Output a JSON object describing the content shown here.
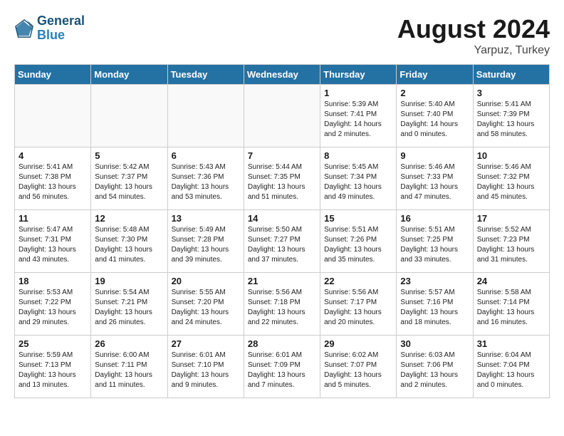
{
  "header": {
    "logo_line1": "General",
    "logo_line2": "Blue",
    "month_year": "August 2024",
    "location": "Yarpuz, Turkey"
  },
  "weekdays": [
    "Sunday",
    "Monday",
    "Tuesday",
    "Wednesday",
    "Thursday",
    "Friday",
    "Saturday"
  ],
  "weeks": [
    [
      {
        "day": "",
        "info": ""
      },
      {
        "day": "",
        "info": ""
      },
      {
        "day": "",
        "info": ""
      },
      {
        "day": "",
        "info": ""
      },
      {
        "day": "1",
        "info": "Sunrise: 5:39 AM\nSunset: 7:41 PM\nDaylight: 14 hours\nand 2 minutes."
      },
      {
        "day": "2",
        "info": "Sunrise: 5:40 AM\nSunset: 7:40 PM\nDaylight: 14 hours\nand 0 minutes."
      },
      {
        "day": "3",
        "info": "Sunrise: 5:41 AM\nSunset: 7:39 PM\nDaylight: 13 hours\nand 58 minutes."
      }
    ],
    [
      {
        "day": "4",
        "info": "Sunrise: 5:41 AM\nSunset: 7:38 PM\nDaylight: 13 hours\nand 56 minutes."
      },
      {
        "day": "5",
        "info": "Sunrise: 5:42 AM\nSunset: 7:37 PM\nDaylight: 13 hours\nand 54 minutes."
      },
      {
        "day": "6",
        "info": "Sunrise: 5:43 AM\nSunset: 7:36 PM\nDaylight: 13 hours\nand 53 minutes."
      },
      {
        "day": "7",
        "info": "Sunrise: 5:44 AM\nSunset: 7:35 PM\nDaylight: 13 hours\nand 51 minutes."
      },
      {
        "day": "8",
        "info": "Sunrise: 5:45 AM\nSunset: 7:34 PM\nDaylight: 13 hours\nand 49 minutes."
      },
      {
        "day": "9",
        "info": "Sunrise: 5:46 AM\nSunset: 7:33 PM\nDaylight: 13 hours\nand 47 minutes."
      },
      {
        "day": "10",
        "info": "Sunrise: 5:46 AM\nSunset: 7:32 PM\nDaylight: 13 hours\nand 45 minutes."
      }
    ],
    [
      {
        "day": "11",
        "info": "Sunrise: 5:47 AM\nSunset: 7:31 PM\nDaylight: 13 hours\nand 43 minutes."
      },
      {
        "day": "12",
        "info": "Sunrise: 5:48 AM\nSunset: 7:30 PM\nDaylight: 13 hours\nand 41 minutes."
      },
      {
        "day": "13",
        "info": "Sunrise: 5:49 AM\nSunset: 7:28 PM\nDaylight: 13 hours\nand 39 minutes."
      },
      {
        "day": "14",
        "info": "Sunrise: 5:50 AM\nSunset: 7:27 PM\nDaylight: 13 hours\nand 37 minutes."
      },
      {
        "day": "15",
        "info": "Sunrise: 5:51 AM\nSunset: 7:26 PM\nDaylight: 13 hours\nand 35 minutes."
      },
      {
        "day": "16",
        "info": "Sunrise: 5:51 AM\nSunset: 7:25 PM\nDaylight: 13 hours\nand 33 minutes."
      },
      {
        "day": "17",
        "info": "Sunrise: 5:52 AM\nSunset: 7:23 PM\nDaylight: 13 hours\nand 31 minutes."
      }
    ],
    [
      {
        "day": "18",
        "info": "Sunrise: 5:53 AM\nSunset: 7:22 PM\nDaylight: 13 hours\nand 29 minutes."
      },
      {
        "day": "19",
        "info": "Sunrise: 5:54 AM\nSunset: 7:21 PM\nDaylight: 13 hours\nand 26 minutes."
      },
      {
        "day": "20",
        "info": "Sunrise: 5:55 AM\nSunset: 7:20 PM\nDaylight: 13 hours\nand 24 minutes."
      },
      {
        "day": "21",
        "info": "Sunrise: 5:56 AM\nSunset: 7:18 PM\nDaylight: 13 hours\nand 22 minutes."
      },
      {
        "day": "22",
        "info": "Sunrise: 5:56 AM\nSunset: 7:17 PM\nDaylight: 13 hours\nand 20 minutes."
      },
      {
        "day": "23",
        "info": "Sunrise: 5:57 AM\nSunset: 7:16 PM\nDaylight: 13 hours\nand 18 minutes."
      },
      {
        "day": "24",
        "info": "Sunrise: 5:58 AM\nSunset: 7:14 PM\nDaylight: 13 hours\nand 16 minutes."
      }
    ],
    [
      {
        "day": "25",
        "info": "Sunrise: 5:59 AM\nSunset: 7:13 PM\nDaylight: 13 hours\nand 13 minutes."
      },
      {
        "day": "26",
        "info": "Sunrise: 6:00 AM\nSunset: 7:11 PM\nDaylight: 13 hours\nand 11 minutes."
      },
      {
        "day": "27",
        "info": "Sunrise: 6:01 AM\nSunset: 7:10 PM\nDaylight: 13 hours\nand 9 minutes."
      },
      {
        "day": "28",
        "info": "Sunrise: 6:01 AM\nSunset: 7:09 PM\nDaylight: 13 hours\nand 7 minutes."
      },
      {
        "day": "29",
        "info": "Sunrise: 6:02 AM\nSunset: 7:07 PM\nDaylight: 13 hours\nand 5 minutes."
      },
      {
        "day": "30",
        "info": "Sunrise: 6:03 AM\nSunset: 7:06 PM\nDaylight: 13 hours\nand 2 minutes."
      },
      {
        "day": "31",
        "info": "Sunrise: 6:04 AM\nSunset: 7:04 PM\nDaylight: 13 hours\nand 0 minutes."
      }
    ]
  ]
}
